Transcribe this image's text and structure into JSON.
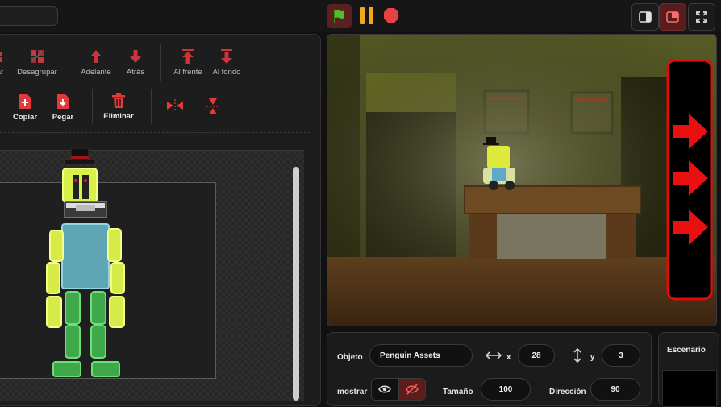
{
  "toolbar": {
    "row1": {
      "ungroup_partial": "ar",
      "ungroup": "Desagrupar",
      "forward": "Adelante",
      "backward": "Atrás",
      "front": "Al frente",
      "back": "Al fondo"
    },
    "row2": {
      "copy": "Copiar",
      "paste": "Pegar",
      "delete": "Eliminar"
    }
  },
  "sprite_info": {
    "object_label": "Objeto",
    "object_name": "Penguin Assets",
    "x_label": "x",
    "x_value": "28",
    "y_label": "y",
    "y_value": "3",
    "show_label": "mostrar",
    "size_label": "Tamaño",
    "size_value": "100",
    "direction_label": "Dirección",
    "direction_value": "90"
  },
  "stage_panel": {
    "title": "Escenario"
  },
  "colors": {
    "accent": "#e03a3a",
    "pause": "#f0a91c",
    "flag": "#4cbf2a",
    "tool_icon": "#d9373b"
  }
}
